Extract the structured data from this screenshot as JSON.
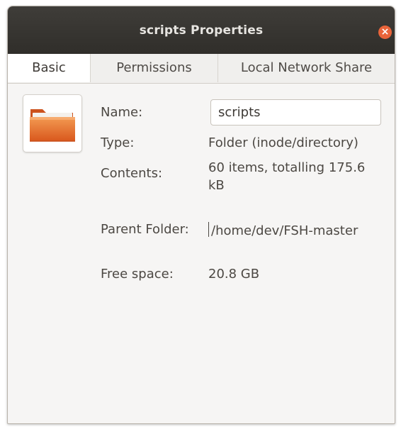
{
  "window": {
    "title": "scripts Properties",
    "close_symbol": "×"
  },
  "tabs": [
    {
      "label": "Basic",
      "active": true
    },
    {
      "label": "Permissions",
      "active": false
    },
    {
      "label": "Local Network Share",
      "active": false
    }
  ],
  "basic": {
    "icon": "orange-folder-icon",
    "name_label": "Name:",
    "name_value": "scripts",
    "type_label": "Type:",
    "type_value": "Folder (inode/directory)",
    "contents_label": "Contents:",
    "contents_value": "60 items, totalling 175.6 kB",
    "parent_label": "Parent Folder:",
    "parent_value": "/home/dev/FSH-master",
    "free_label": "Free space:",
    "free_value": "20.8 GB"
  },
  "colors": {
    "titlebar": "#302e2a",
    "close_button": "#e9643a",
    "folder_orange": "#e86f2a",
    "window_background": "#f6f5f4"
  }
}
